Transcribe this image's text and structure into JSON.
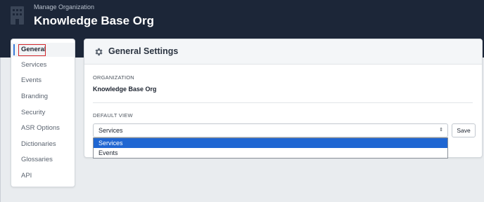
{
  "header": {
    "subtitle": "Manage Organization",
    "title": "Knowledge Base Org"
  },
  "sidebar": {
    "items": [
      {
        "label": "General",
        "active": true
      },
      {
        "label": "Services"
      },
      {
        "label": "Events"
      },
      {
        "label": "Branding"
      },
      {
        "label": "Security"
      },
      {
        "label": "ASR Options"
      },
      {
        "label": "Dictionaries"
      },
      {
        "label": "Glossaries"
      },
      {
        "label": "API"
      }
    ]
  },
  "panel": {
    "title": "General Settings",
    "icon": "gear-icon",
    "organization_label": "ORGANIZATION",
    "organization_value": "Knowledge Base Org",
    "default_view_label": "DEFAULT VIEW",
    "default_view_value": "Services",
    "save_label": "Save"
  },
  "dropdown": {
    "options": [
      "Services",
      "Events"
    ],
    "selected": "Services"
  },
  "colors": {
    "header_bg": "#1c2638",
    "highlight": "#d2262b",
    "selected_option": "#1f66d2",
    "active_bar": "#3b7bd8"
  }
}
